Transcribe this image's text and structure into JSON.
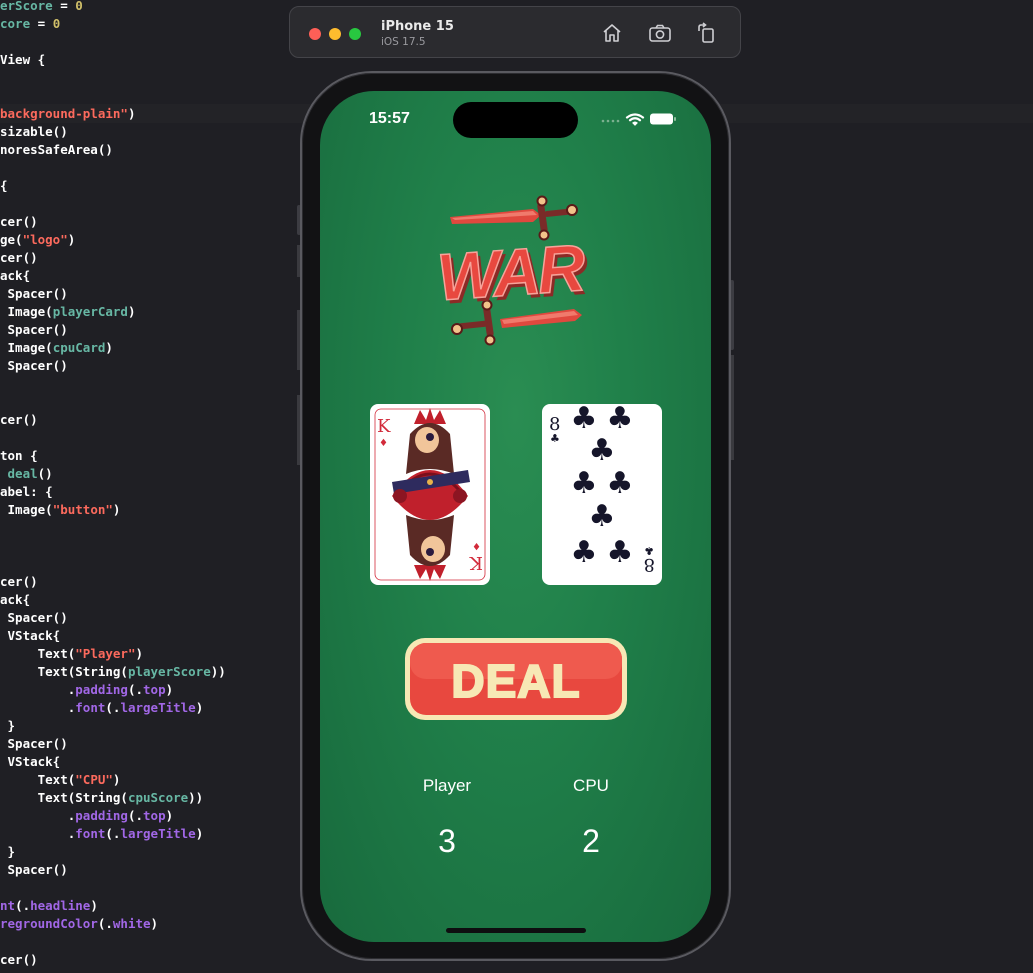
{
  "simulator": {
    "device": "iPhone 15",
    "os": "iOS 17.5",
    "buttons": [
      "home-icon",
      "screenshot-icon",
      "rotate-icon"
    ]
  },
  "editor": {
    "lines": [
      "erScore = 0",
      "core = 0",
      "",
      "View {",
      "",
      "",
      "background-plain\")",
      "sizable()",
      "noresSafeArea()",
      "",
      "{",
      "",
      "cer()",
      "ge(\"logo\")",
      "cer()",
      "ack{",
      " Spacer()",
      " Image(playerCard)",
      " Spacer()",
      " Image(cpuCard)",
      " Spacer()",
      "",
      "",
      "cer()",
      "",
      "ton {",
      " deal()",
      "abel: {",
      " Image(\"button\")",
      "",
      "",
      "",
      "cer()",
      "ack{",
      " Spacer()",
      " VStack{",
      "     Text(\"Player\")",
      "     Text(String(playerScore))",
      "         .padding(.top)",
      "         .font(.largeTitle)",
      " }",
      " Spacer()",
      " VStack{",
      "     Text(\"CPU\")",
      "     Text(String(cpuScore))",
      "         .padding(.top)",
      "         .font(.largeTitle)",
      " }",
      " Spacer()",
      "",
      "nt(.headline)",
      "regroundColor(.white)",
      "",
      "cer()"
    ]
  },
  "app": {
    "time": "15:57",
    "logo_text": "WAR",
    "player_card": {
      "rank": "K",
      "suit": "♦",
      "image": "king-of-diamonds"
    },
    "cpu_card": {
      "rank": "8",
      "suit": "♣",
      "image": "eight-of-clubs"
    },
    "deal_label": "DEAL",
    "player_label": "Player",
    "cpu_label": "CPU",
    "player_score": "3",
    "cpu_score": "2"
  },
  "colors": {
    "felt": "#20804a",
    "deal_red": "#e8483f",
    "deal_cream": "#f7e8b5",
    "sword_red": "#e0483e",
    "code_string": "#fc6a5d",
    "code_keyword": "#a167e6"
  }
}
